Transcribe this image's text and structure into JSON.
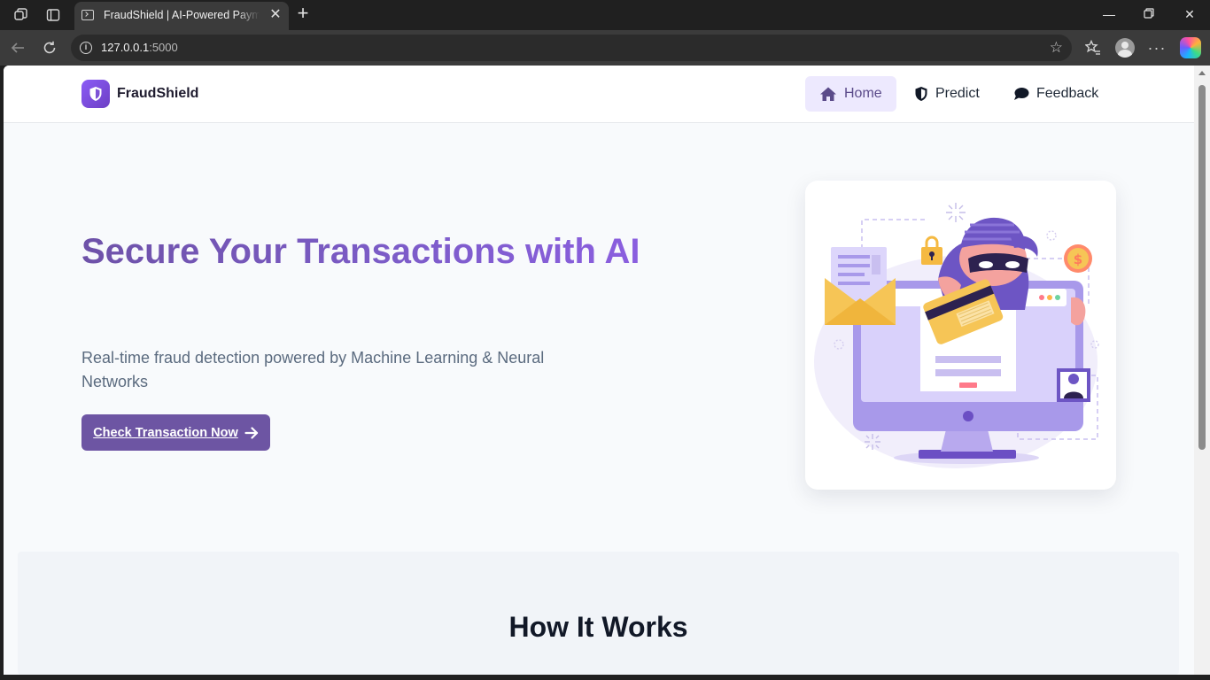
{
  "browser": {
    "tab_title": "FraudShield | AI-Powered Payment Fraud Detection",
    "url_host": "127.0.0.1",
    "url_port": ":5000",
    "icons": [
      "workspaces-icon",
      "tab-actions-icon",
      "back-icon",
      "refresh-icon",
      "site-info-icon",
      "favorite-star-icon",
      "favorites-icon",
      "profile-icon",
      "more-icon",
      "copilot-icon"
    ]
  },
  "site_nav": {
    "brand": "FraudShield",
    "items": [
      {
        "label": "Home",
        "icon": "home-icon",
        "active": true
      },
      {
        "label": "Predict",
        "icon": "shield-icon",
        "active": false
      },
      {
        "label": "Feedback",
        "icon": "chat-bubble-icon",
        "active": false
      }
    ]
  },
  "hero": {
    "title": "Secure Your Transactions with AI",
    "subtitle": "Real-time fraud detection powered by Machine Learning & Neural Networks",
    "cta_label": "Check Transaction Now",
    "cta_icon": "arrow-right-icon",
    "illustration": "hacker-stealing-credit-card-illustration"
  },
  "how_it_works": {
    "title": "How It Works"
  },
  "colors": {
    "accent": "#6d55a3",
    "accent_light": "#ede9fe",
    "title_gradient_start": "#6e52a8",
    "title_gradient_end": "#8b5fe0",
    "page_bg": "#f8fafc"
  }
}
